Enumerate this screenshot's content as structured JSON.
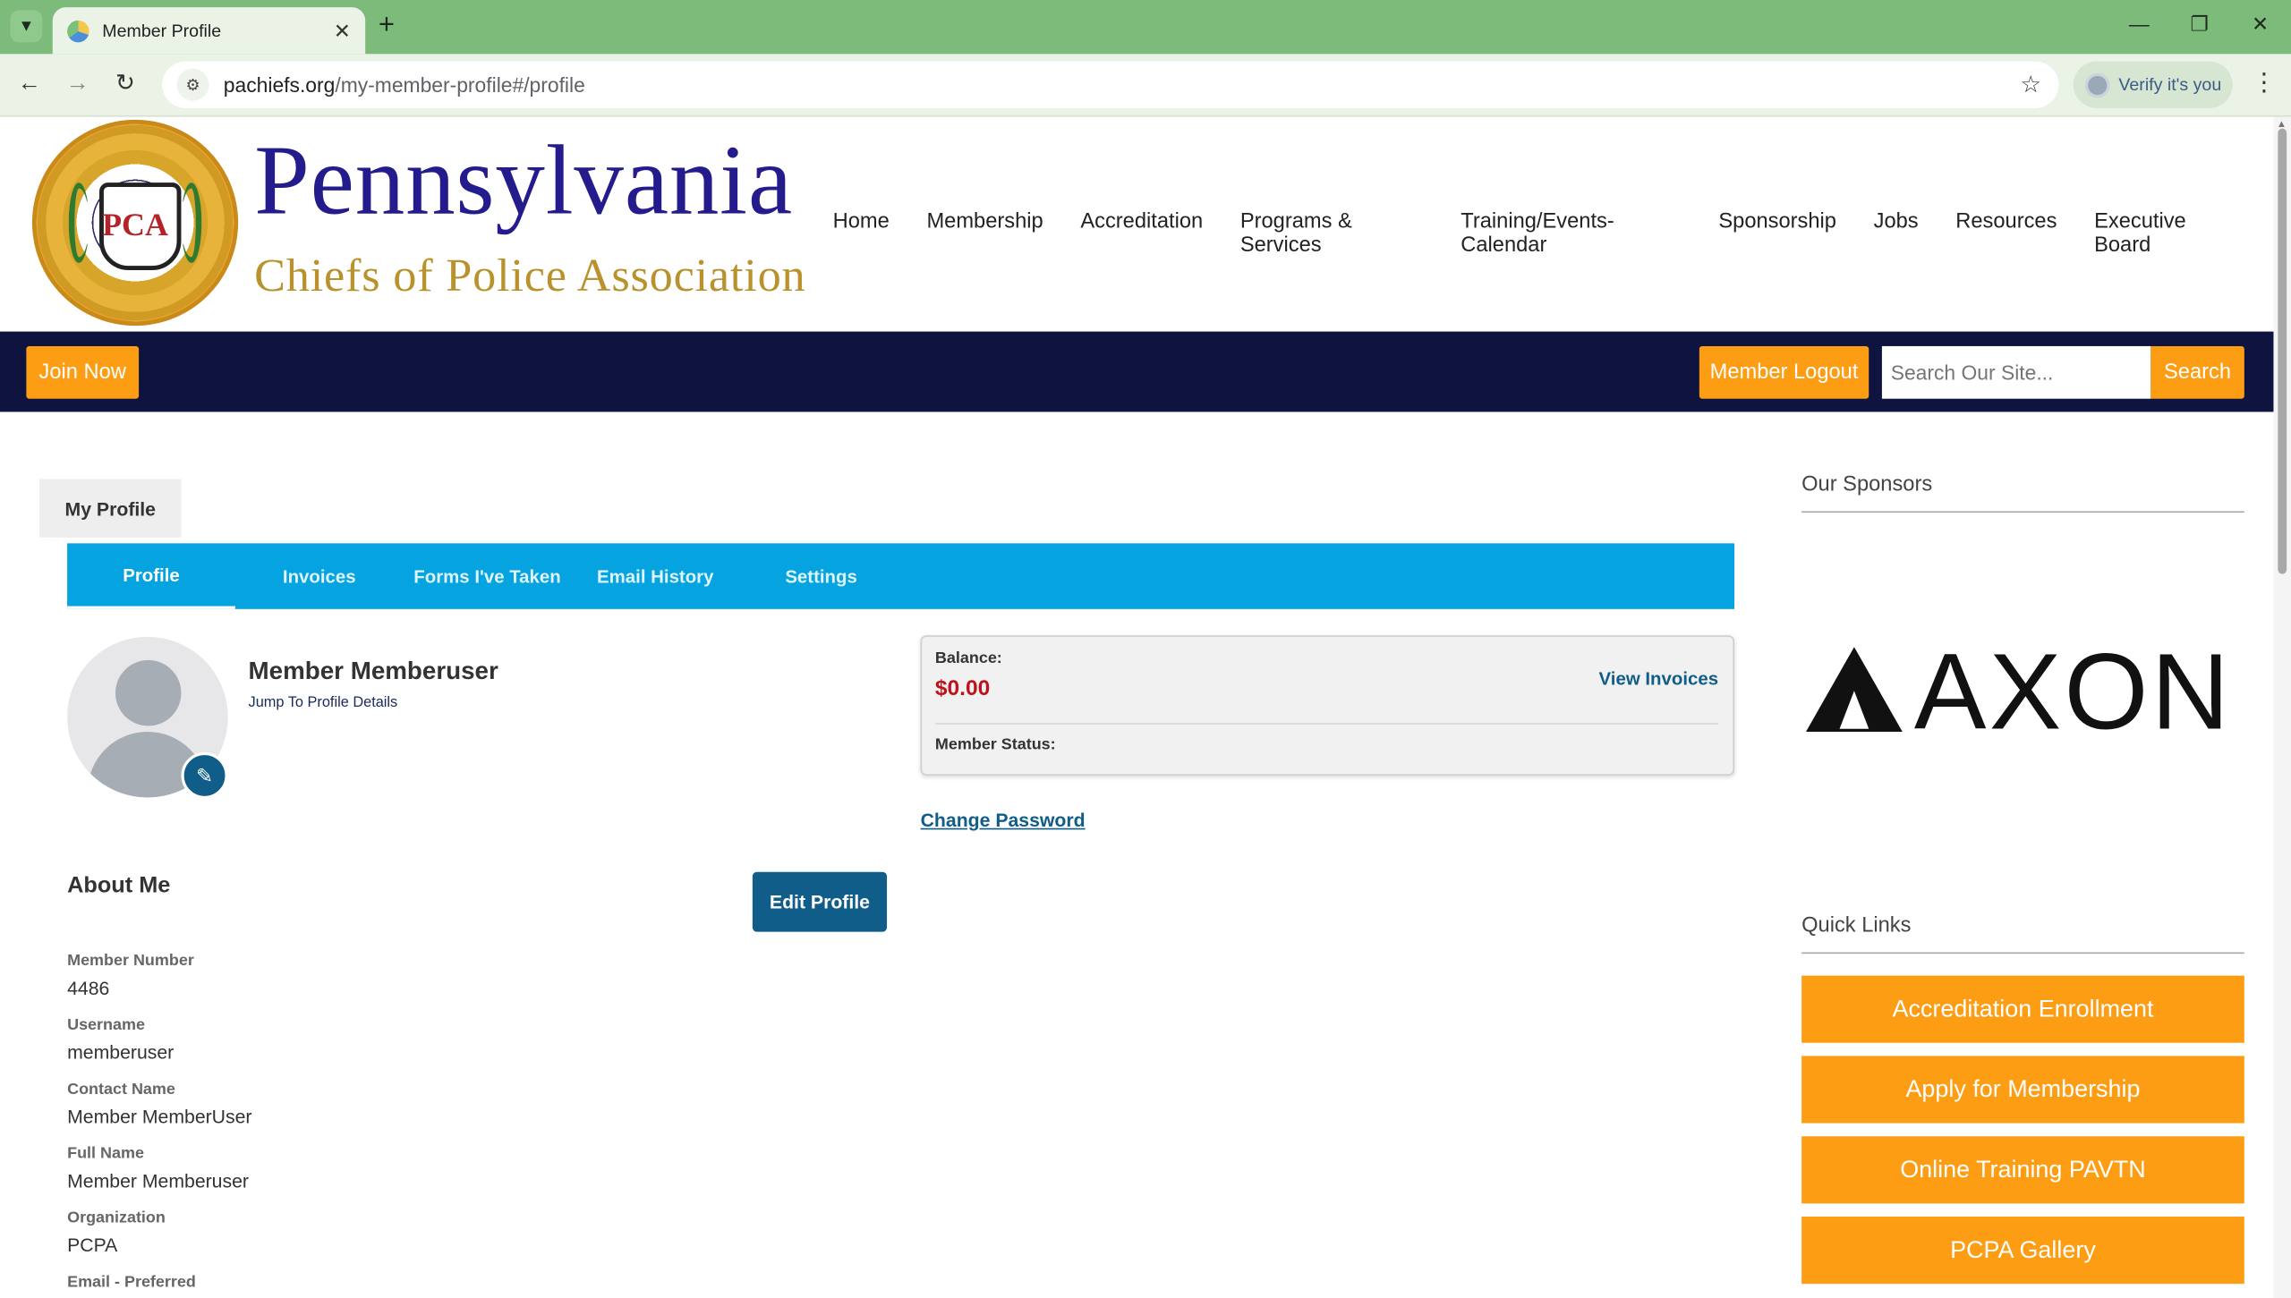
{
  "browser": {
    "tab_title": "Member Profile",
    "url_host": "pachiefs.org",
    "url_path": "/my-member-profile#/profile",
    "verify_label": "Verify it's you"
  },
  "header": {
    "seal_letters": "PCA",
    "brand_top": "Pennsylvania",
    "brand_bottom": "Chiefs of Police Association",
    "nav": [
      "Home",
      "Membership",
      "Accreditation",
      "Programs & Services",
      "Training/Events-Calendar",
      "Sponsorship",
      "Jobs",
      "Resources",
      "Executive Board"
    ]
  },
  "navbar": {
    "join_label": "Join Now",
    "logout_label": "Member Logout",
    "search_placeholder": "Search Our Site...",
    "search_button": "Search"
  },
  "profile": {
    "page_tab": "My Profile",
    "subnav": [
      "Profile",
      "Invoices",
      "Forms I've Taken",
      "Email History",
      "Settings"
    ],
    "active_subnav": "Profile",
    "member_name": "Member Memberuser",
    "jump_link": "Jump To Profile Details",
    "balance_label": "Balance:",
    "balance_amount": "$0.00",
    "view_invoices": "View Invoices",
    "status_label": "Member Status:",
    "change_password": "Change Password",
    "about_title": "About Me",
    "edit_profile": "Edit Profile",
    "fields": [
      {
        "label": "Member Number",
        "value": "4486"
      },
      {
        "label": "Username",
        "value": "memberuser"
      },
      {
        "label": "Contact Name",
        "value": "Member MemberUser"
      },
      {
        "label": "Full Name",
        "value": "Member Memberuser"
      },
      {
        "label": "Organization",
        "value": "PCPA"
      },
      {
        "label": "Email - Preferred",
        "value": ""
      }
    ]
  },
  "sidebar": {
    "sponsors_title": "Our Sponsors",
    "sponsor_logo_text": "AXON",
    "quick_links_title": "Quick Links",
    "quick_links": [
      "Accreditation Enrollment",
      "Apply for Membership",
      "Online Training PAVTN",
      "PCPA Gallery"
    ]
  },
  "colors": {
    "navy": "#0f1340",
    "orange": "#fd9d14",
    "subnav_blue": "#05a3e0",
    "button_blue": "#0f5d88",
    "balance_red": "#c0121b",
    "brand_purple": "#241c8c",
    "brand_gold": "#b9922d",
    "chrome_green": "#7dbb7b"
  }
}
